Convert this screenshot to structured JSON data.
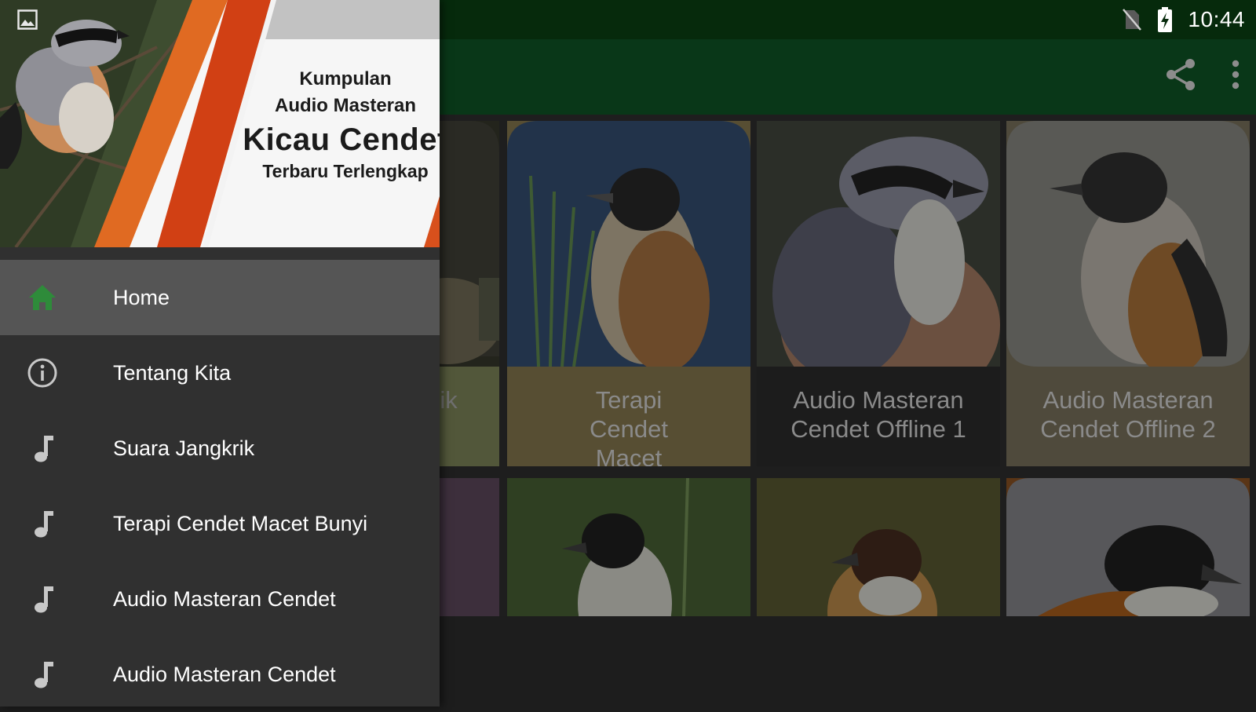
{
  "status_bar": {
    "time": "10:44",
    "icons": [
      "image-notification-icon",
      "no-sim-icon",
      "battery-charging-icon"
    ]
  },
  "app_bar": {
    "actions": [
      "share-icon",
      "more-vert-icon"
    ]
  },
  "grid": {
    "row1": [
      {
        "title": "rik",
        "art": "cricket"
      },
      {
        "title": "Terapi Cendet Macet Bunyi",
        "art": "shrike-blue-bg"
      },
      {
        "title": "Audio Masteran Cendet Offline 1",
        "art": "shrike-dark-bg"
      },
      {
        "title": "Audio Masteran Cendet Offline 2",
        "art": "shrike-grey-bg"
      }
    ],
    "row2": [
      "partial",
      "shrike-green",
      "shrike-olive",
      "shrike-orange-frame"
    ]
  },
  "drawer": {
    "header": {
      "line1": "Kumpulan",
      "line2": "Audio Masteran",
      "line3": "Kicau Cendet",
      "line4": "Terbaru Terlengkap"
    },
    "items": [
      {
        "label": "Home",
        "icon": "home-icon",
        "active": true
      },
      {
        "label": "Tentang Kita",
        "icon": "info-icon",
        "active": false
      },
      {
        "label": "Suara Jangkrik",
        "icon": "music-note-icon",
        "active": false
      },
      {
        "label": "Terapi Cendet Macet Bunyi",
        "icon": "music-note-icon",
        "active": false
      },
      {
        "label": "Audio Masteran Cendet",
        "icon": "music-note-icon",
        "active": false
      },
      {
        "label": "Audio Masteran Cendet",
        "icon": "music-note-icon",
        "active": false
      }
    ]
  },
  "colors": {
    "status_bar": "#062a0c",
    "app_bar": "#093718",
    "drawer_bg": "#303030",
    "active_item": "#555555",
    "home_icon": "#2e8b3a",
    "accent_orange": "#d8501c"
  }
}
